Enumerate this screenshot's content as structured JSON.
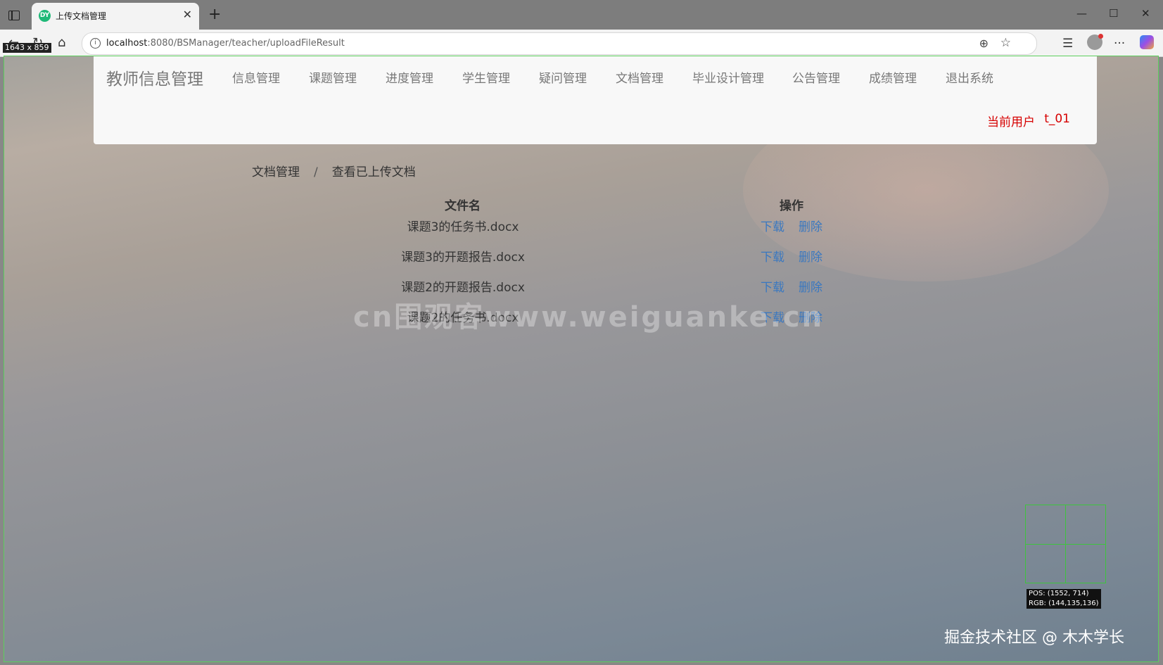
{
  "browser": {
    "tab_title": "上传文档管理",
    "favicon_text": "DY",
    "url_host": "localhost",
    "url_rest": ":8080/BSManager/teacher/uploadFileResult",
    "size_badge": "1643 x 859"
  },
  "navbar": {
    "brand": "教师信息管理",
    "items": [
      "信息管理",
      "课题管理",
      "进度管理",
      "学生管理",
      "疑问管理",
      "文档管理",
      "毕业设计管理",
      "公告管理",
      "成绩管理",
      "退出系统"
    ],
    "user_label": "当前用户",
    "user_name": "t_01"
  },
  "breadcrumb": {
    "parent": "文档管理",
    "separator": "/",
    "current": "查看已上传文档"
  },
  "table": {
    "headers": [
      "文件名",
      "操作"
    ],
    "rows": [
      {
        "filename": "课题3的任务书.docx",
        "download": "下载",
        "delete": "删除"
      },
      {
        "filename": "课题3的开题报告.docx",
        "download": "下载",
        "delete": "删除"
      },
      {
        "filename": "课题2的开题报告.docx",
        "download": "下载",
        "delete": "删除"
      },
      {
        "filename": "课题2的任务书.docx",
        "download": "下载",
        "delete": "删除"
      }
    ]
  },
  "overlay": {
    "watermark": "cn围观客www.weiguanke.cn",
    "picker_pos": "POS: (1552, 714)",
    "picker_rgb": "RGB: (144,135,136)",
    "footer_mark": "掘金技术社区 @ 木木学长"
  },
  "colors": {
    "user_red": "#d60000",
    "link_blue": "#3a78c0",
    "guide_green": "#3ec43e"
  }
}
